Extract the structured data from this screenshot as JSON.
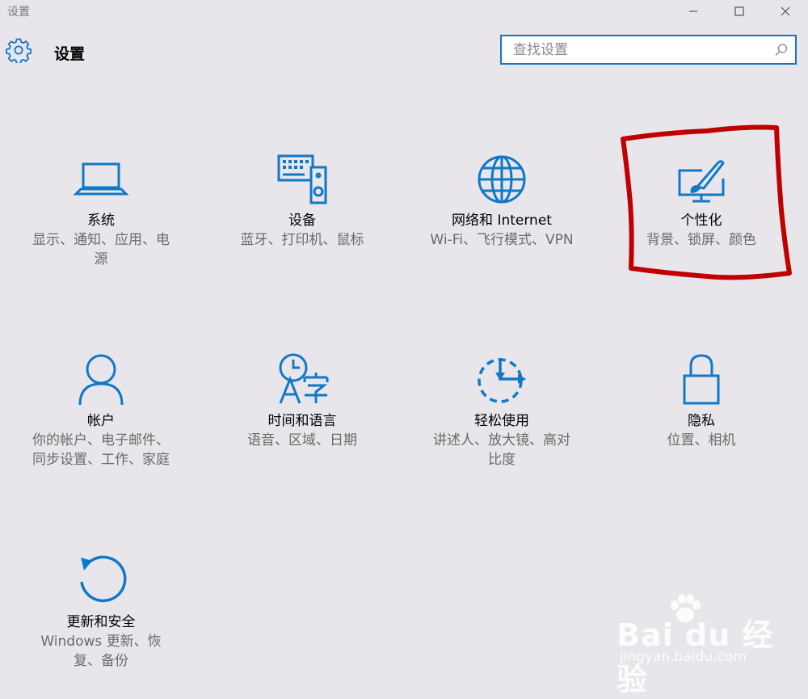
{
  "window": {
    "title": "设置",
    "minimize_icon": "minimize-icon",
    "maximize_icon": "maximize-icon",
    "close_icon": "close-icon"
  },
  "header": {
    "icon": "gear-icon",
    "title": "设置"
  },
  "search": {
    "placeholder": "查找设置",
    "value": "",
    "icon": "search-icon"
  },
  "accent_color": "#1178c8",
  "highlight_color": "#c00000",
  "tiles": [
    {
      "name": "系统",
      "desc_line1": "显示、通知、应用、电",
      "desc_line2": "源",
      "icon": "laptop-icon"
    },
    {
      "name": "设备",
      "desc_line1": "蓝牙、打印机、鼠标",
      "desc_line2": "",
      "icon": "keyboard-speaker-icon"
    },
    {
      "name": "网络和 Internet",
      "desc_line1": "Wi-Fi、飞行模式、VPN",
      "desc_line2": "",
      "icon": "globe-icon"
    },
    {
      "name": "个性化",
      "desc_line1": "背景、锁屏、颜色",
      "desc_line2": "",
      "icon": "paint-monitor-icon"
    },
    {
      "name": "帐户",
      "desc_line1": "你的帐户、电子邮件、",
      "desc_line2": "同步设置、工作、家庭",
      "icon": "person-icon"
    },
    {
      "name": "时间和语言",
      "desc_line1": "语音、区域、日期",
      "desc_line2": "",
      "icon": "clock-language-icon"
    },
    {
      "name": "轻松使用",
      "desc_line1": "讲述人、放大镜、高对",
      "desc_line2": "比度",
      "icon": "ease-of-access-icon"
    },
    {
      "name": "隐私",
      "desc_line1": "位置、相机",
      "desc_line2": "",
      "icon": "lock-icon"
    },
    {
      "name": "更新和安全",
      "desc_line1": "Windows 更新、恢",
      "desc_line2": "复、备份",
      "icon": "refresh-icon"
    }
  ],
  "watermark": {
    "brand": "Bai du 经验",
    "url": "jingyan.baidu.com"
  }
}
